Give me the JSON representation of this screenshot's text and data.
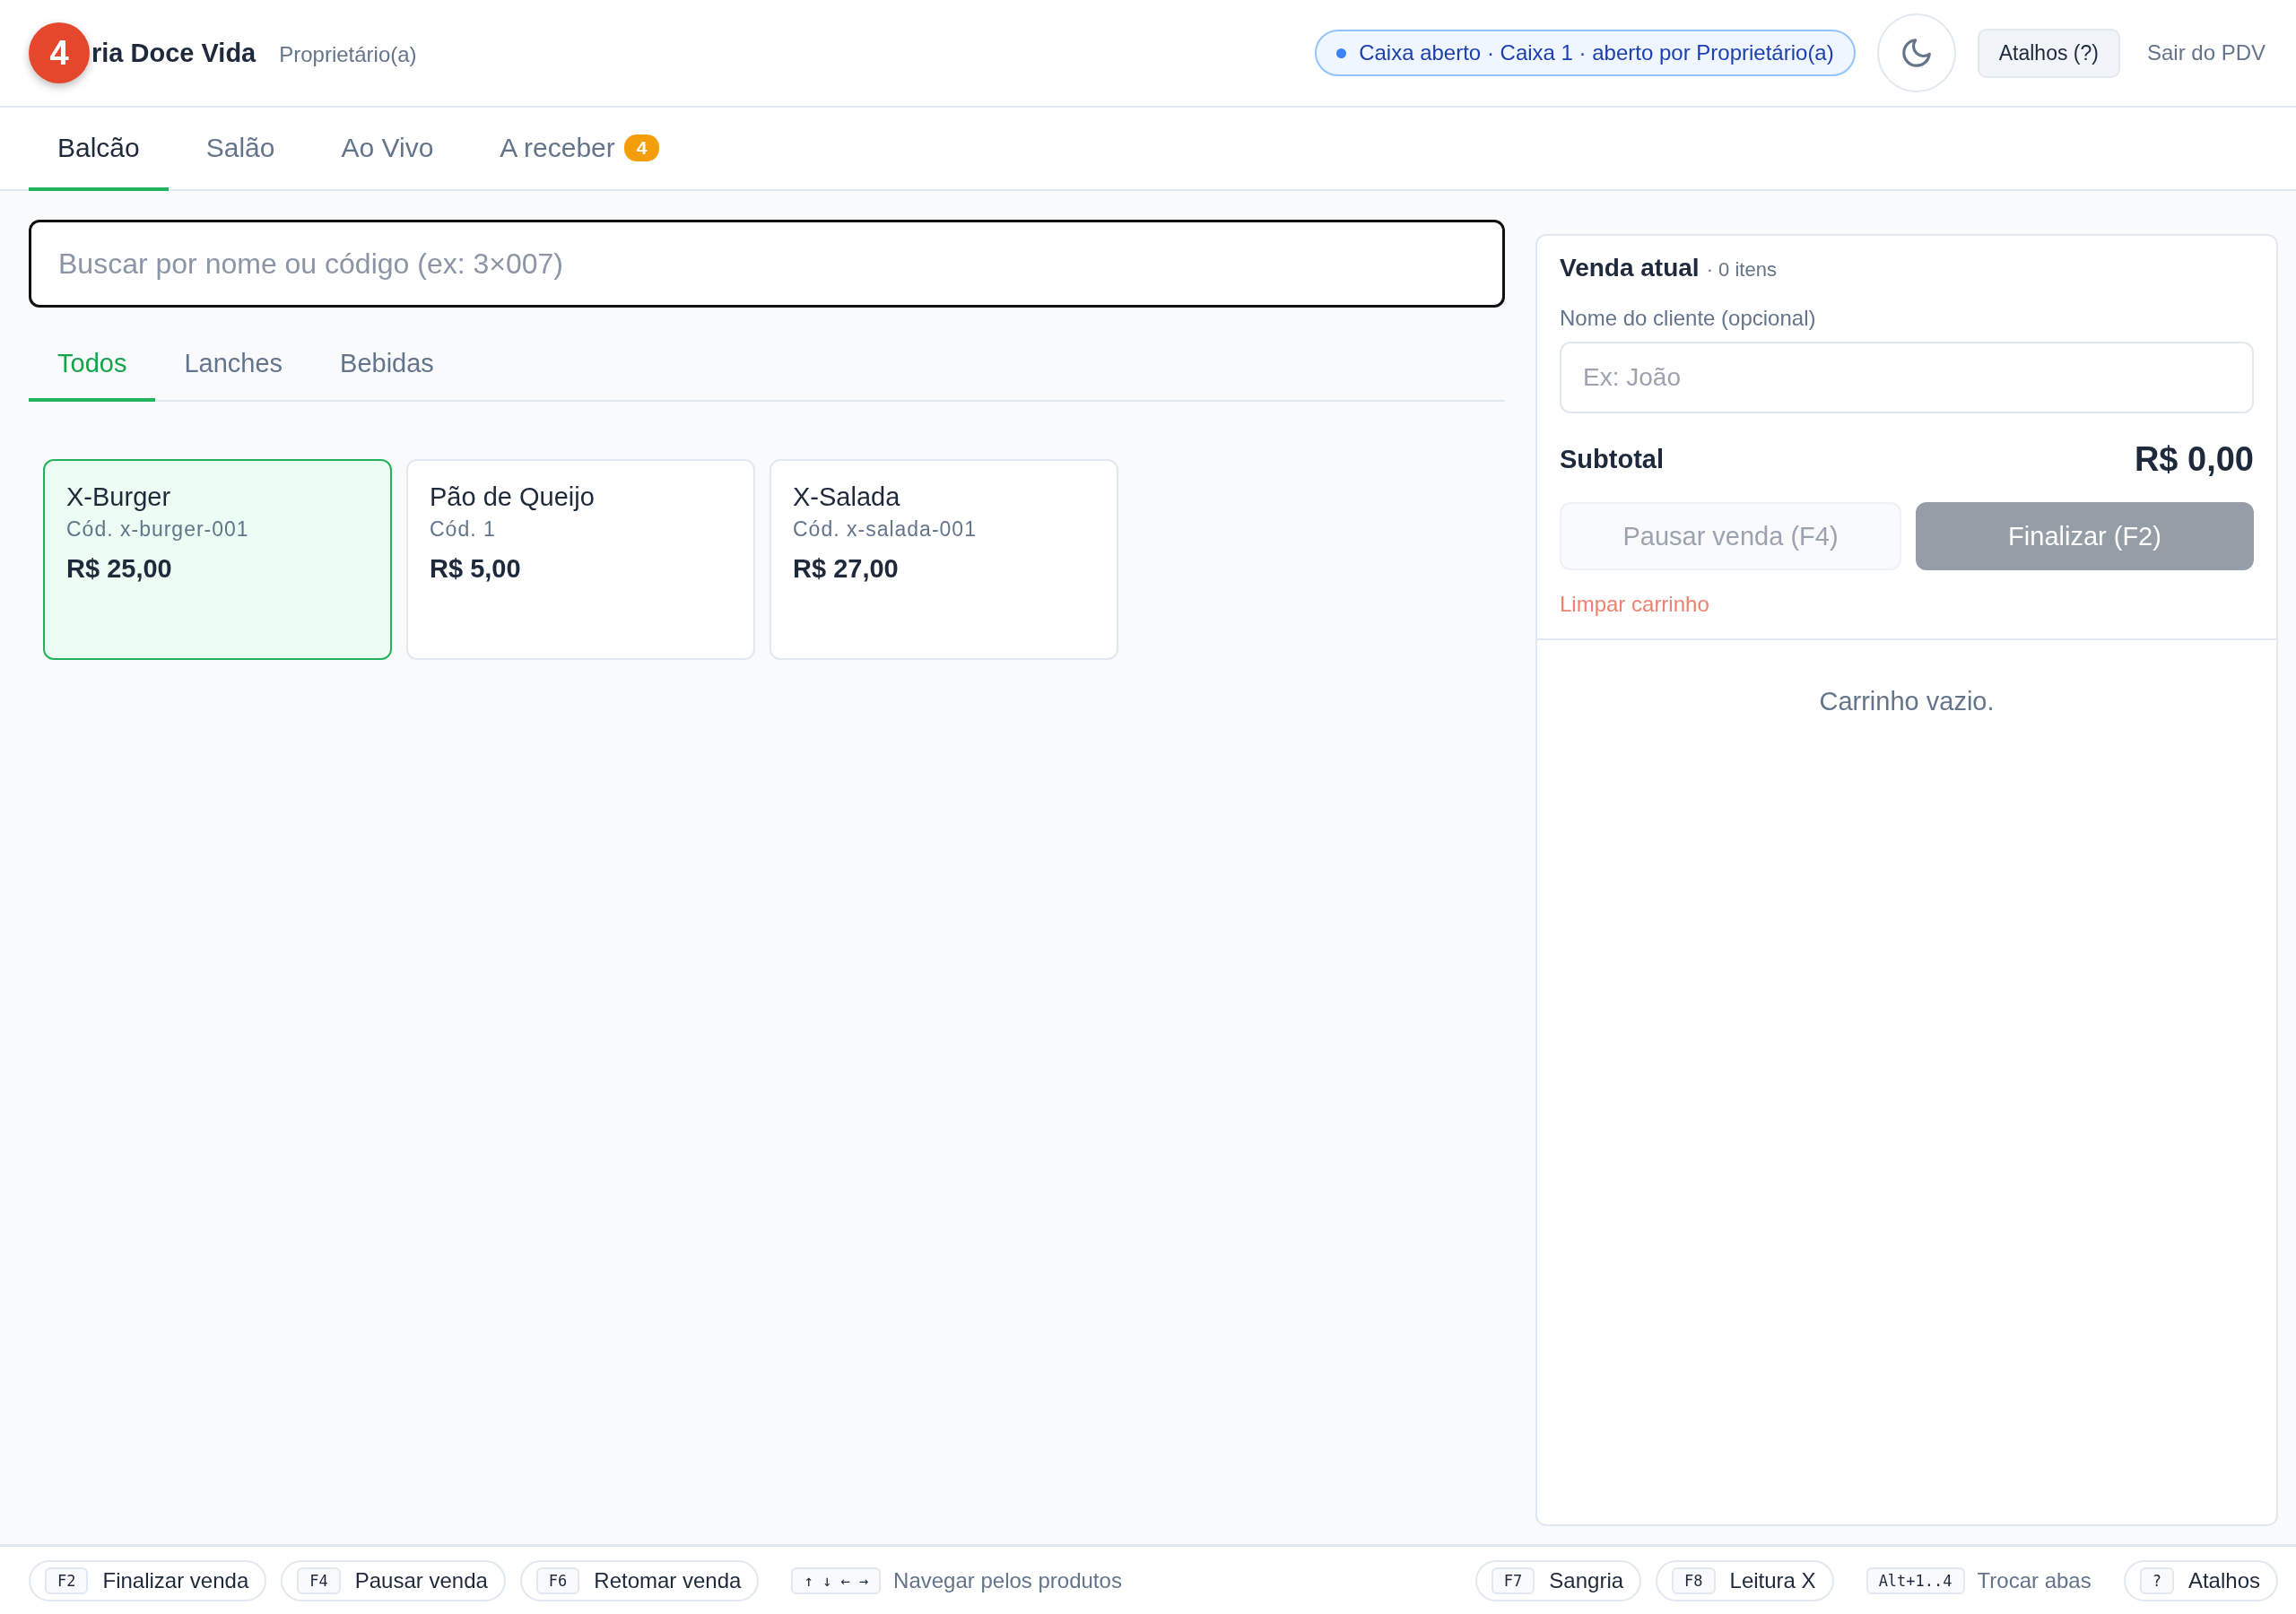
{
  "header": {
    "overlay_badge": "4",
    "brand": "ria Doce Vida",
    "role": "Proprietário(a)",
    "status": "Caixa aberto · Caixa 1 · aberto por Proprietário(a)",
    "shortcuts_button": "Atalhos (?)",
    "exit_link": "Sair do PDV"
  },
  "tabs": [
    {
      "label": "Balcão",
      "selected": true
    },
    {
      "label": "Salão",
      "selected": false
    },
    {
      "label": "Ao Vivo",
      "selected": false
    },
    {
      "label": "A receber",
      "selected": false,
      "badge": "4"
    }
  ],
  "search": {
    "placeholder": "Buscar por nome ou código (ex: 3×007)"
  },
  "categories": [
    {
      "label": "Todos",
      "selected": true
    },
    {
      "label": "Lanches",
      "selected": false
    },
    {
      "label": "Bebidas",
      "selected": false
    }
  ],
  "products": [
    {
      "name": "X-Burger",
      "code": "Cód. x-burger-001",
      "price": "R$ 25,00",
      "selected": true
    },
    {
      "name": "Pão de Queijo",
      "code": "Cód. 1",
      "price": "R$ 5,00",
      "selected": false
    },
    {
      "name": "X-Salada",
      "code": "Cód. x-salada-001",
      "price": "R$ 27,00",
      "selected": false
    }
  ],
  "sale": {
    "title": "Venda atual",
    "count": "· 0 itens",
    "customer_label": "Nome do cliente (opcional)",
    "customer_placeholder": "Ex: João",
    "subtotal_label": "Subtotal",
    "subtotal": "R$ 0,00",
    "pause_button": {
      "label": "Pausar venda (F4)",
      "disabled": true
    },
    "finalize_button": {
      "label": "Finalizar (F2)",
      "disabled": true
    },
    "clear_link": "Limpar carrinho",
    "empty_message": "Carrinho vazio."
  },
  "footer": {
    "left": [
      {
        "key": "F2",
        "label": "Finalizar venda",
        "kind": "chip"
      },
      {
        "key": "F4",
        "label": "Pausar venda",
        "kind": "chip"
      },
      {
        "key": "F6",
        "label": "Retomar venda",
        "kind": "chip"
      },
      {
        "key": "↑ ↓ ← →",
        "label": "Navegar pelos produtos",
        "kind": "plain"
      }
    ],
    "right": [
      {
        "key": "F7",
        "label": "Sangria",
        "kind": "chip"
      },
      {
        "key": "F8",
        "label": "Leitura X",
        "kind": "chip"
      },
      {
        "key": "Alt+1..4",
        "label": "Trocar abas",
        "kind": "plain"
      },
      {
        "key": "?",
        "label": "Atalhos",
        "kind": "chip"
      }
    ]
  }
}
